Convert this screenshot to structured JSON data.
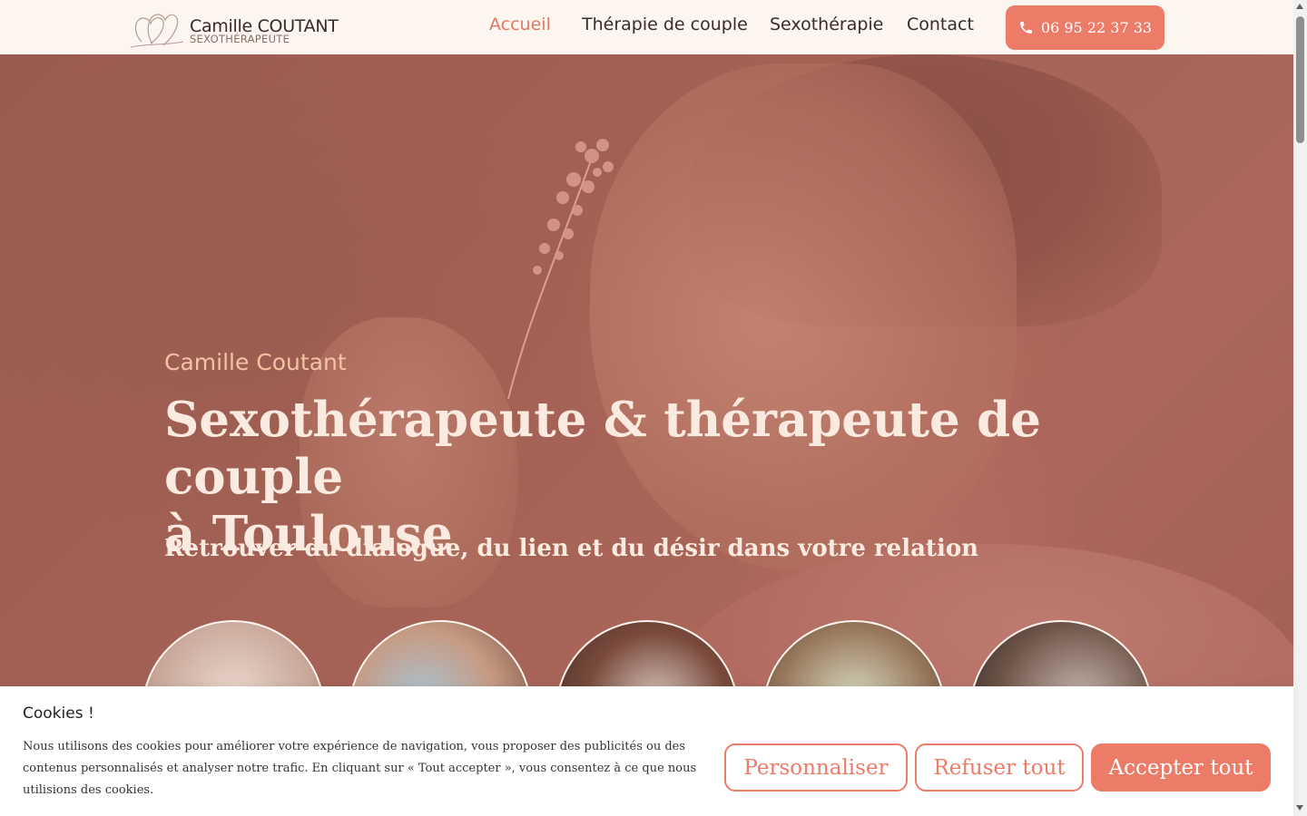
{
  "header": {
    "logo_name": "Camille COUTANT",
    "logo_sub": "SEXOTHÉRAPEUTE",
    "nav": [
      {
        "label": "Accueil",
        "active": true
      },
      {
        "label": "Thérapie de couple",
        "active": false
      },
      {
        "label": "Sexothérapie",
        "active": false
      },
      {
        "label": "Contact",
        "active": false
      }
    ],
    "phone": "06 95 22 37 33",
    "phone_icon": "phone-icon"
  },
  "hero": {
    "kicker": "Camille Coutant",
    "title_line1": "Sexothérapeute & thérapeute de couple",
    "title_line2": "à Toulouse",
    "subtitle": "Retrouver du dialogue, du lien et du désir dans votre relation"
  },
  "cookie": {
    "title": "Cookies !",
    "text": "Nous utilisons des cookies pour améliorer votre expérience de navigation, vous proposer des publicités ou des contenus personnalisés et analyser notre trafic. En cliquant sur « Tout accepter », vous consentez à ce que nous utilisions des cookies.",
    "btn_customize": "Personnaliser",
    "btn_refuse": "Refuser tout",
    "btn_accept": "Accepter tout"
  },
  "colors": {
    "accent": "#ec7b68",
    "background": "#fdf5f0",
    "hero_text": "#fbeadf",
    "kicker": "#f3c3a4"
  }
}
